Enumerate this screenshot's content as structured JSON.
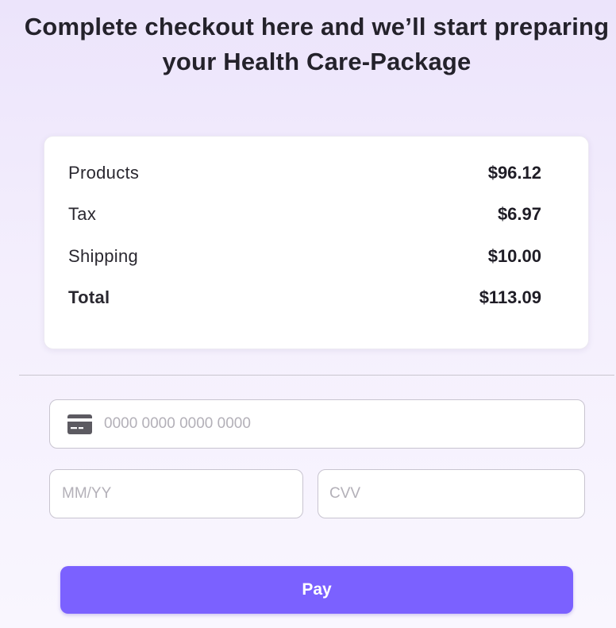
{
  "header": {
    "title_line1": "Complete checkout here and we’ll start preparing",
    "title_line2": "your Health Care-Package"
  },
  "summary": {
    "rows": [
      {
        "label": "Products",
        "value": "$96.12"
      },
      {
        "label": "Tax",
        "value": "$6.97"
      },
      {
        "label": "Shipping",
        "value": "$10.00"
      }
    ],
    "total": {
      "label": "Total",
      "value": "$113.09"
    }
  },
  "payment": {
    "card_icon": "credit-card-icon",
    "card_number_placeholder": "0000 0000 0000 0000",
    "expiry_placeholder": "MM/YY",
    "cvv_placeholder": "CVV"
  },
  "actions": {
    "pay_label": "Pay"
  },
  "colors": {
    "accent": "#7b61ff",
    "background": "#f1ebfd"
  }
}
